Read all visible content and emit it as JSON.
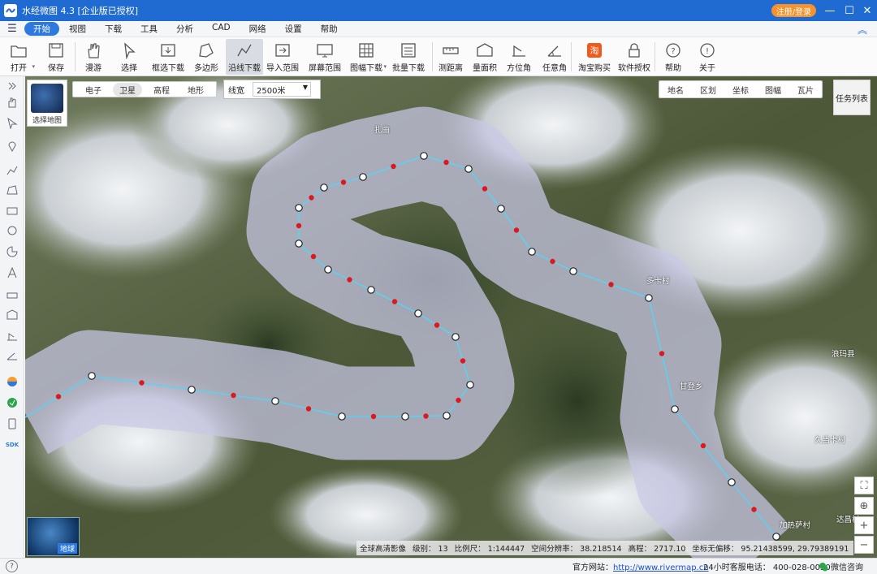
{
  "app": {
    "title": "水经微图 4.3 [企业版已授权]",
    "register_label": "注册/登录"
  },
  "menu": {
    "items": [
      "开始",
      "视图",
      "下载",
      "工具",
      "分析",
      "CAD",
      "网络",
      "设置",
      "帮助"
    ],
    "active": 0
  },
  "toolbar": {
    "items": [
      {
        "label": "打开",
        "icon": "folder-icon",
        "dropdown": true
      },
      {
        "label": "保存",
        "icon": "save-icon"
      },
      {
        "label": "漫游",
        "icon": "hand-icon"
      },
      {
        "label": "选择",
        "icon": "cursor-icon"
      },
      {
        "label": "框选下载",
        "icon": "rect-download-icon"
      },
      {
        "label": "多边形",
        "icon": "polygon-icon"
      },
      {
        "label": "沿线下载",
        "icon": "line-download-icon",
        "active": true
      },
      {
        "label": "导入范围",
        "icon": "import-icon"
      },
      {
        "label": "屏幕范围",
        "icon": "screen-icon"
      },
      {
        "label": "图幅下载",
        "icon": "grid-icon",
        "dropdown": true
      },
      {
        "label": "批量下载",
        "icon": "batch-icon"
      },
      {
        "label": "测距离",
        "icon": "ruler-icon"
      },
      {
        "label": "量面积",
        "icon": "area-icon"
      },
      {
        "label": "方位角",
        "icon": "azimuth-icon"
      },
      {
        "label": "任意角",
        "icon": "angle-icon"
      },
      {
        "label": "淘宝购买",
        "icon": "taobao-icon"
      },
      {
        "label": "软件授权",
        "icon": "lock-icon"
      },
      {
        "label": "帮助",
        "icon": "help-icon"
      },
      {
        "label": "关于",
        "icon": "info-icon"
      }
    ]
  },
  "map": {
    "basemap_label": "选择地图",
    "map_types": [
      "电子",
      "卫星",
      "高程",
      "地形"
    ],
    "map_type_active": 1,
    "linewidth_label": "线宽",
    "linewidth_value": "2500米",
    "layers": [
      "地名",
      "区划",
      "坐标",
      "图幅",
      "瓦片"
    ],
    "task_list": "任务列表",
    "globe_label": "地球",
    "places": [
      {
        "name": "扎曲"
      },
      {
        "name": "多卡村"
      },
      {
        "name": "甘登乡"
      },
      {
        "name": "浪玛县"
      },
      {
        "name": "久当卡村"
      },
      {
        "name": "加热萨村"
      },
      {
        "name": "达昌村"
      }
    ],
    "status": {
      "source": "全球高清影像",
      "level": "级别： 13",
      "scale": "比例尺： 1:144447",
      "resolution": "空间分辨率： 38.218514",
      "elevation": "高程： 2717.10",
      "coords": "坐标无偏移： 95.21438599, 29.79389191"
    }
  },
  "footer": {
    "site_label": "官方网站：",
    "site_url": "http://www.rivermap.cn",
    "phone": "24小时客服电话： 400-028-0050",
    "wechat": "微信咨询"
  },
  "colors": {
    "accent": "#2e79e0",
    "title_bar": "#1f6bd1",
    "register": "#f7922a",
    "route_line": "#5fd0f0",
    "waypoint_mid": "#e0181e"
  }
}
